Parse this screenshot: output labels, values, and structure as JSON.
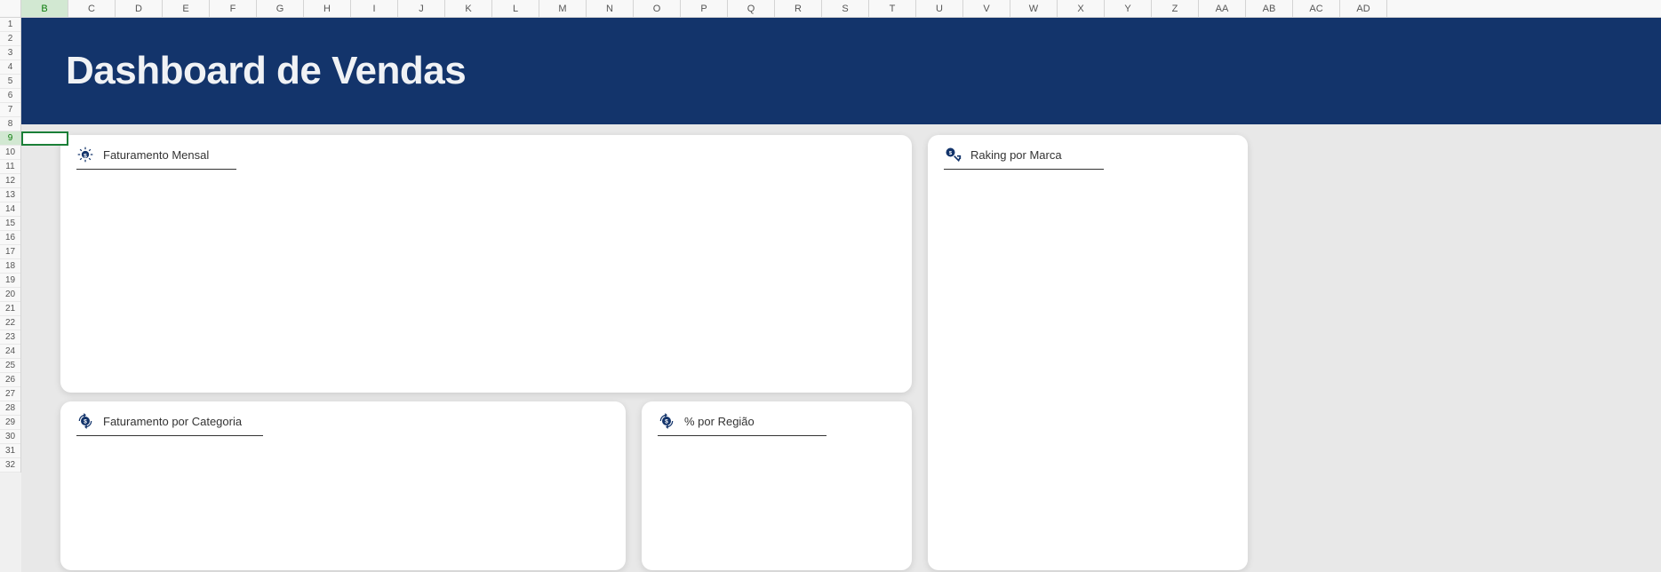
{
  "columns": [
    "B",
    "C",
    "D",
    "E",
    "F",
    "G",
    "H",
    "I",
    "J",
    "K",
    "L",
    "M",
    "N",
    "O",
    "P",
    "Q",
    "R",
    "S",
    "T",
    "U",
    "V",
    "W",
    "X",
    "Y",
    "Z",
    "AA",
    "AB",
    "AC",
    "AD"
  ],
  "rows": [
    "1",
    "2",
    "3",
    "4",
    "5",
    "6",
    "7",
    "8",
    "9",
    "10",
    "11",
    "12",
    "13",
    "14",
    "15",
    "16",
    "17",
    "18",
    "19",
    "20",
    "21",
    "22",
    "23",
    "24",
    "25",
    "26",
    "27",
    "28",
    "29",
    "30",
    "31",
    "32"
  ],
  "selected_column": "B",
  "selected_row": "9",
  "dashboard": {
    "title": "Dashboard de Vendas"
  },
  "cards": {
    "faturamento_mensal": {
      "title": "Faturamento Mensal"
    },
    "ranking_marca": {
      "title": "Raking por Marca"
    },
    "faturamento_categoria": {
      "title": "Faturamento por Categoria"
    },
    "por_regiao": {
      "title": "% por Região"
    }
  }
}
